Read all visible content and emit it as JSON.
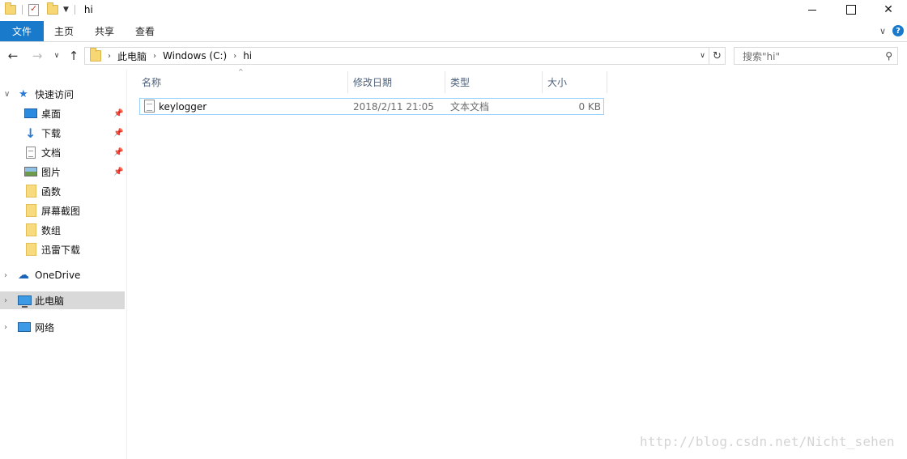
{
  "window": {
    "title": "hi"
  },
  "ribbon": {
    "tabs": [
      "文件",
      "主页",
      "共享",
      "查看"
    ],
    "help": "?"
  },
  "address": {
    "crumbs": [
      "此电脑",
      "Windows (C:)",
      "hi"
    ],
    "search_placeholder": "搜索\"hi\""
  },
  "navpane": {
    "quick_access": "快速访问",
    "items": [
      {
        "label": "桌面",
        "icon": "desktop-icon",
        "pinned": true
      },
      {
        "label": "下载",
        "icon": "download-icon",
        "pinned": true
      },
      {
        "label": "文档",
        "icon": "document-icon",
        "pinned": true
      },
      {
        "label": "图片",
        "icon": "pictures-icon",
        "pinned": true
      },
      {
        "label": "函数",
        "icon": "folder-icon",
        "pinned": false
      },
      {
        "label": "屏幕截图",
        "icon": "folder-icon",
        "pinned": false
      },
      {
        "label": "数组",
        "icon": "folder-icon",
        "pinned": false
      },
      {
        "label": "迅雷下载",
        "icon": "folder-icon",
        "pinned": false
      }
    ],
    "onedrive": "OneDrive",
    "this_pc": "此电脑",
    "network": "网络"
  },
  "columns": [
    "名称",
    "修改日期",
    "类型",
    "大小"
  ],
  "files": [
    {
      "name": "keylogger",
      "modified": "2018/2/11 21:05",
      "type": "文本文档",
      "size": "0 KB"
    }
  ],
  "watermark": "http://blog.csdn.net/Nicht_sehen"
}
